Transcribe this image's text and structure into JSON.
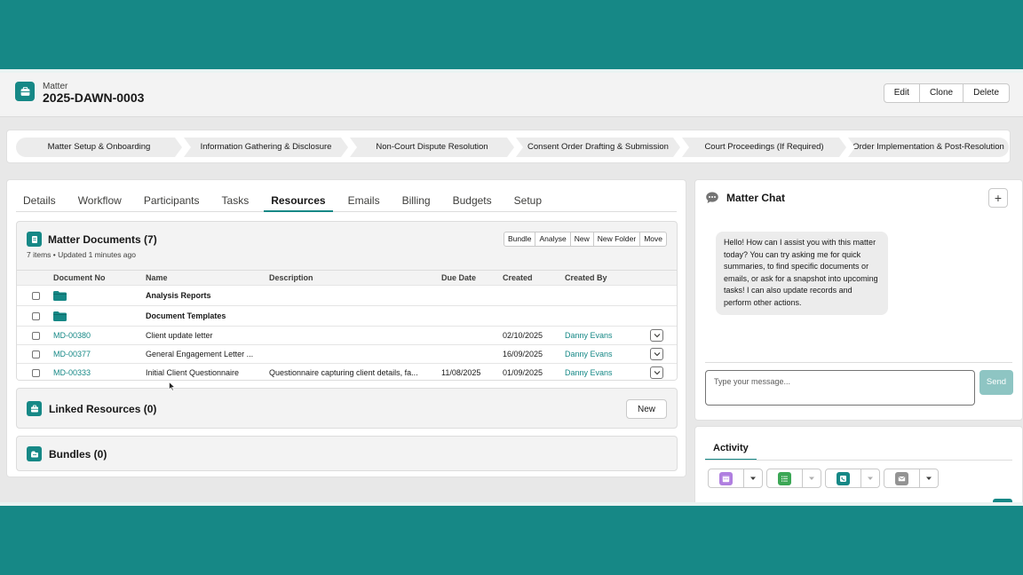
{
  "header": {
    "object_type": "Matter",
    "record_name": "2025-DAWN-0003",
    "actions": [
      "Edit",
      "Clone",
      "Delete"
    ]
  },
  "path": {
    "steps": [
      "Matter Setup & Onboarding",
      "Information Gathering & Disclosure",
      "Non-Court Dispute Resolution",
      "Consent Order Drafting & Submission",
      "Court Proceedings (If Required)",
      "Order Implementation & Post-Resolution"
    ]
  },
  "tabs": [
    "Details",
    "Workflow",
    "Participants",
    "Tasks",
    "Resources",
    "Emails",
    "Billing",
    "Budgets",
    "Setup"
  ],
  "active_tab": "Resources",
  "documents": {
    "title": "Matter Documents (7)",
    "subtitle": "7 items • Updated 1 minutes ago",
    "actions": [
      "Bundle",
      "Analyse",
      "New",
      "New Folder",
      "Move"
    ],
    "columns": [
      "Document No",
      "Name",
      "Description",
      "Due Date",
      "Created",
      "Created By"
    ],
    "folders": [
      {
        "name": "Analysis Reports"
      },
      {
        "name": "Document Templates"
      }
    ],
    "rows": [
      {
        "doc_no": "MD-00380",
        "name": "Client update letter",
        "description": "",
        "due_date": "",
        "created": "02/10/2025",
        "created_by": "Danny Evans"
      },
      {
        "doc_no": "MD-00377",
        "name": "General Engagement Letter ...",
        "description": "",
        "due_date": "",
        "created": "16/09/2025",
        "created_by": "Danny Evans"
      },
      {
        "doc_no": "MD-00333",
        "name": "Initial Client Questionnaire",
        "description": "Questionnaire capturing client details, fa...",
        "due_date": "11/08/2025",
        "created": "01/09/2025",
        "created_by": "Danny Evans"
      }
    ]
  },
  "linked_resources": {
    "title": "Linked Resources (0)",
    "new_label": "New"
  },
  "bundles": {
    "title": "Bundles (0)"
  },
  "chat": {
    "title": "Matter Chat",
    "plus_label": "+",
    "message": "Hello! How can I assist you with this matter today? You can try asking me for quick summaries, to find specific documents or emails, or ask for a snapshot into upcoming tasks! I can also update records and perform other actions.",
    "input_placeholder": "Type your message...",
    "send_label": "Send"
  },
  "activity": {
    "tab_label": "Activity",
    "buttons": [
      {
        "icon": "calendar-icon",
        "color": "#b07fe0"
      },
      {
        "icon": "task-icon",
        "color": "#3ba755"
      },
      {
        "icon": "phone-icon",
        "color": "#168886"
      },
      {
        "icon": "email-icon",
        "color": "#939393"
      }
    ]
  },
  "colors": {
    "brand": "#168886",
    "link": "#168886"
  }
}
